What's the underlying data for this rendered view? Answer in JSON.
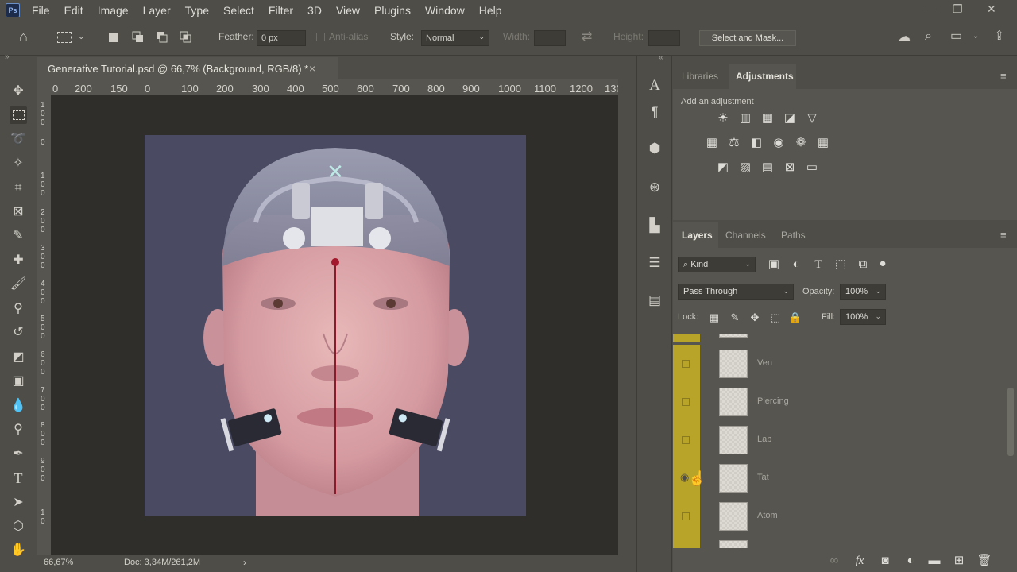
{
  "app": {
    "logo": "Ps"
  },
  "menu": [
    "File",
    "Edit",
    "Image",
    "Layer",
    "Type",
    "Select",
    "Filter",
    "3D",
    "View",
    "Plugins",
    "Window",
    "Help"
  ],
  "window_controls": {
    "minimize": "—",
    "restore": "❐",
    "close": "✕"
  },
  "options": {
    "feather_label": "Feather:",
    "feather_value": "0 px",
    "antialias_label": "Anti-alias",
    "style_label": "Style:",
    "style_value": "Normal",
    "width_label": "Width:",
    "height_label": "Height:",
    "select_mask_label": "Select and Mask..."
  },
  "document": {
    "tab_title": "Generative Tutorial.psd @ 66,7% (Background, RGB/8) *",
    "tab_close": "×",
    "ruler_top": [
      "0",
      "200",
      "150",
      "0",
      "100",
      "200",
      "300",
      "400",
      "500",
      "600",
      "700",
      "800",
      "900",
      "1000",
      "1100",
      "1200",
      "130"
    ],
    "ruler_left": [
      "1 0 0",
      "0",
      "1 0 0",
      "2 0 0",
      "3 0 0",
      "4 0 0",
      "5 0 0",
      "6 0 0",
      "7 0 0",
      "8 0 0",
      "9 0 0",
      "1 0"
    ],
    "zoom": "66,67%",
    "doc_info": "Doc: 3,34M/261,2M",
    "status_arrow": "›"
  },
  "panels_top": {
    "tabs": [
      "Libraries",
      "Adjustments"
    ],
    "active_tab": "Adjustments",
    "add_adjustment": "Add an adjustment"
  },
  "layers_panel": {
    "tabs": [
      "Layers",
      "Channels",
      "Paths"
    ],
    "active_tab": "Layers",
    "filter_kind": "Kind",
    "blend_mode": "Pass Through",
    "opacity_label": "Opacity:",
    "opacity_value": "100%",
    "lock_label": "Lock:",
    "fill_label": "Fill:",
    "fill_value": "100%",
    "layers": [
      {
        "name": "Ven",
        "visible": false
      },
      {
        "name": "Piercing",
        "visible": false
      },
      {
        "name": "Lab",
        "visible": false
      },
      {
        "name": "Tat",
        "visible": true
      },
      {
        "name": "Atom",
        "visible": false
      }
    ],
    "layer_group_color": "#b9a42a"
  },
  "colors": {
    "ui_bg": "#4e4d47",
    "canvas_bg": "#4a4a63",
    "guide_line": "#8b1a2a"
  }
}
